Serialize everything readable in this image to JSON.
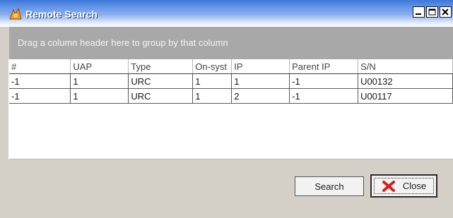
{
  "window": {
    "title": "Remote Search",
    "controls": {
      "minimize": "_",
      "maximize": "□",
      "close": "X"
    }
  },
  "group_panel": {
    "hint": "Drag a column header here to group by that column"
  },
  "grid": {
    "columns": [
      "#",
      "UAP",
      "Type",
      "On-syst",
      "IP",
      "Parent IP",
      "S/N"
    ],
    "rows": [
      [
        "-1",
        "1",
        "URC",
        "1",
        "1",
        "-1",
        "U00132"
      ],
      [
        "-1",
        "1",
        "URC",
        "1",
        "2",
        "-1",
        "U00117"
      ]
    ]
  },
  "buttons": {
    "search": "Search",
    "close": "Close"
  },
  "icons": {
    "app": "app-icon",
    "close_button_icon": "red-x-icon"
  },
  "colors": {
    "title_bar": "#3c76d8",
    "group_panel": "#a8a8a8",
    "close_icon": "#d42020"
  }
}
